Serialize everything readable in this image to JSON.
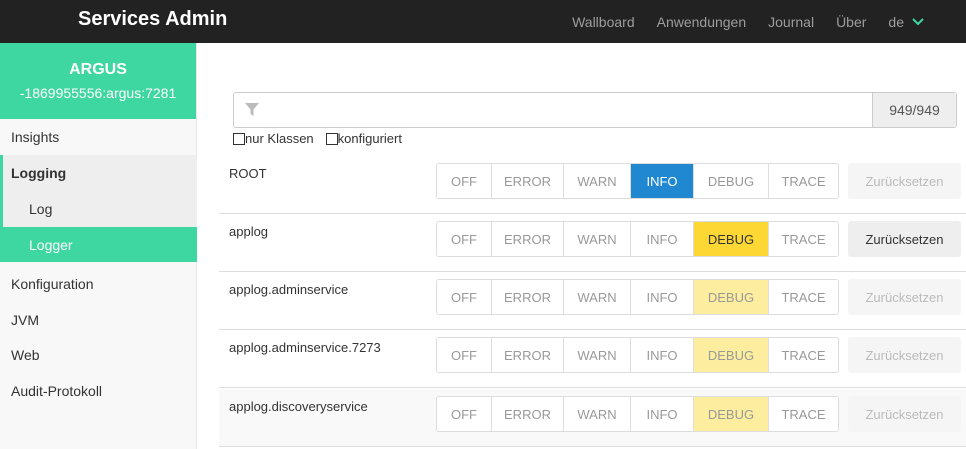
{
  "navbar": {
    "brand": "Services Admin",
    "links": [
      "Wallboard",
      "Anwendungen",
      "Journal",
      "Über"
    ],
    "lang": "de"
  },
  "sidebar": {
    "app_name": "ARGUS",
    "instance": "-1869955556:argus:7281",
    "items": {
      "insights": "Insights",
      "logging": "Logging",
      "log": "Log",
      "logger": "Logger",
      "konfiguration": "Konfiguration",
      "jvm": "JVM",
      "web": "Web",
      "audit": "Audit-Protokoll"
    }
  },
  "filter": {
    "placeholder": "",
    "count": "949/949",
    "only_classes": "nur Klassen",
    "configured": "konfiguriert"
  },
  "levels": [
    "OFF",
    "ERROR",
    "WARN",
    "INFO",
    "DEBUG",
    "TRACE"
  ],
  "reset_label": "Zurücksetzen",
  "loggers": [
    {
      "name": "ROOT",
      "level": "INFO",
      "state": "configured",
      "reset_enabled": false
    },
    {
      "name": "applog",
      "level": "DEBUG",
      "state": "configured",
      "reset_enabled": true
    },
    {
      "name": "applog.adminservice",
      "level": "DEBUG",
      "state": "inherited",
      "reset_enabled": false
    },
    {
      "name": "applog.adminservice.7273",
      "level": "DEBUG",
      "state": "inherited",
      "reset_enabled": false
    },
    {
      "name": "applog.discoveryservice",
      "level": "DEBUG",
      "state": "inherited",
      "reset_enabled": false
    }
  ],
  "colors": {
    "accent": "#3ed6a1",
    "navbar": "#222222",
    "info_selected": "#1f88d0",
    "debug_selected": "#fdd835",
    "debug_inherited": "#fcee9e"
  }
}
